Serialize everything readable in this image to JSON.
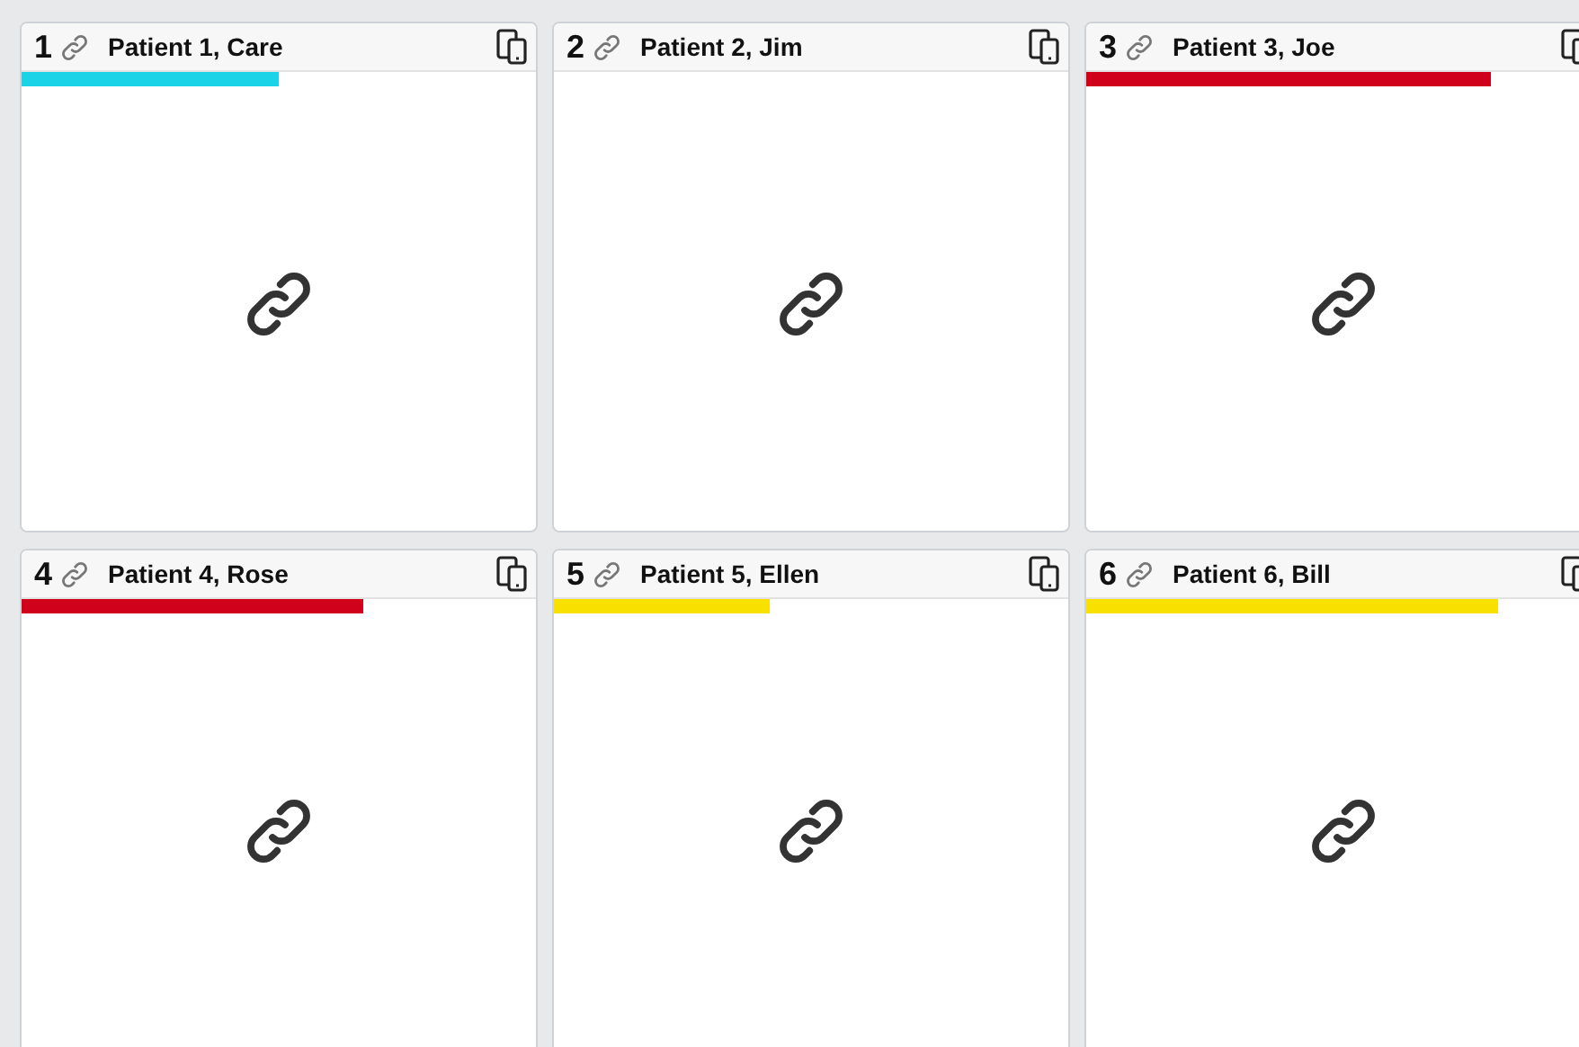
{
  "patients": [
    {
      "number": "1",
      "name": "Patient 1, Care",
      "level": 0.5,
      "color": "#1ad3e6"
    },
    {
      "number": "2",
      "name": "Patient 2, Jim"
    },
    {
      "number": "3",
      "name": "Patient 3, Joe",
      "level": 0.785,
      "color": "#d0021b"
    },
    {
      "number": "4",
      "name": "Patient 4, Rose",
      "level": 0.665,
      "color": "#d0021b"
    },
    {
      "number": "5",
      "name": "Patient 5, Ellen",
      "level": 0.42,
      "color": "#f8e000"
    },
    {
      "number": "6",
      "name": "Patient 6, Bill",
      "level": 0.8,
      "color": "#f8e000"
    }
  ]
}
